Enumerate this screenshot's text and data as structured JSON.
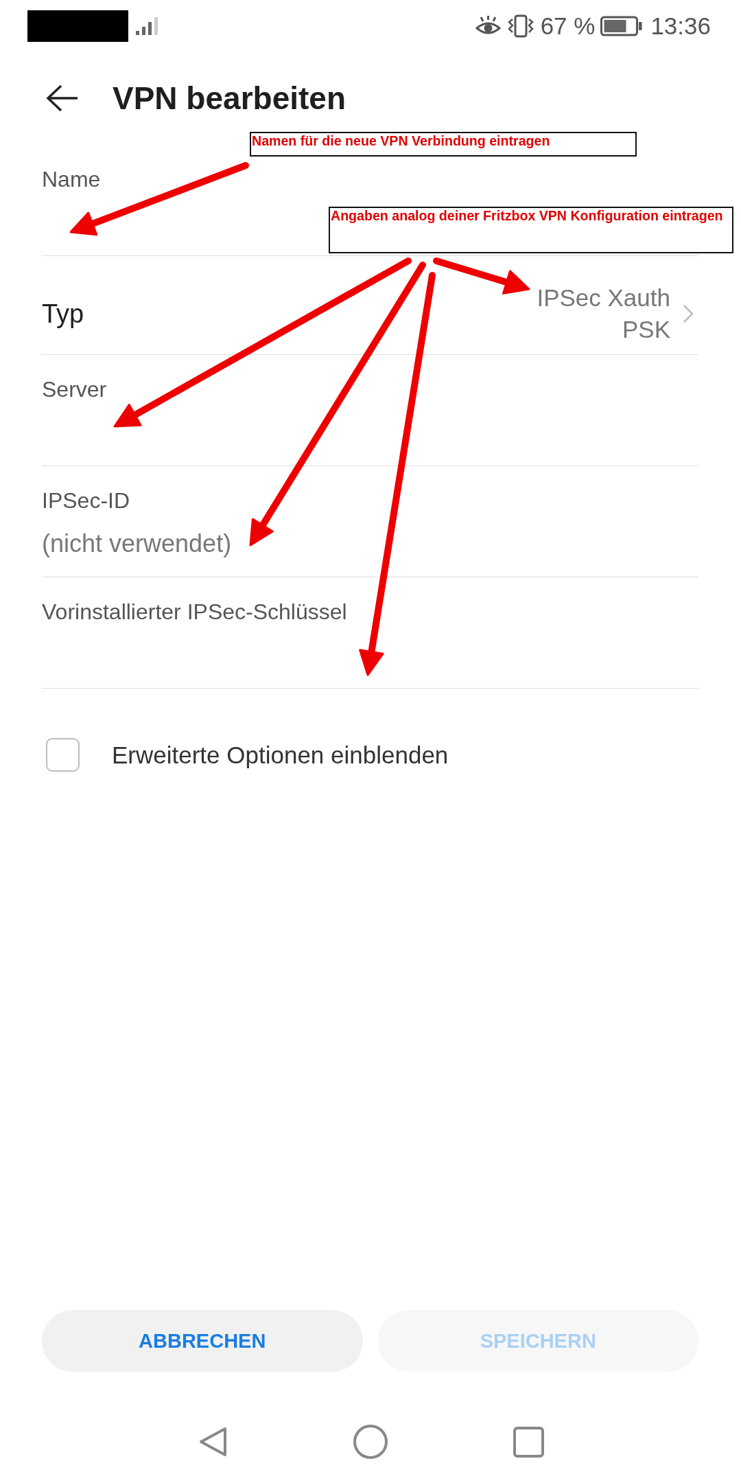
{
  "status_bar": {
    "battery_percent": "67 %",
    "time": "13:36"
  },
  "app_bar": {
    "title": "VPN bearbeiten"
  },
  "fields": [
    {
      "kind": "input",
      "label": "Name"
    },
    {
      "kind": "select",
      "label": "Typ",
      "value": "IPSec Xauth PSK"
    },
    {
      "kind": "input",
      "label": "Server"
    },
    {
      "kind": "input",
      "label": "IPSec-ID",
      "placeholder": "(nicht verwendet)"
    },
    {
      "kind": "input",
      "label": "Vorinstallierter IPSec-Schlüssel"
    }
  ],
  "advanced_options": {
    "label": "Erweiterte Optionen einblenden",
    "checked": false
  },
  "buttons": [
    {
      "label": "ABBRECHEN",
      "disabled": false
    },
    {
      "label": "SPEICHERN",
      "disabled": true
    }
  ],
  "annotations": [
    {
      "text": "Namen für die neue VPN Verbindung eintragen"
    },
    {
      "text": "Angaben analog deiner Fritzbox VPN Konfiguration eintragen"
    }
  ]
}
